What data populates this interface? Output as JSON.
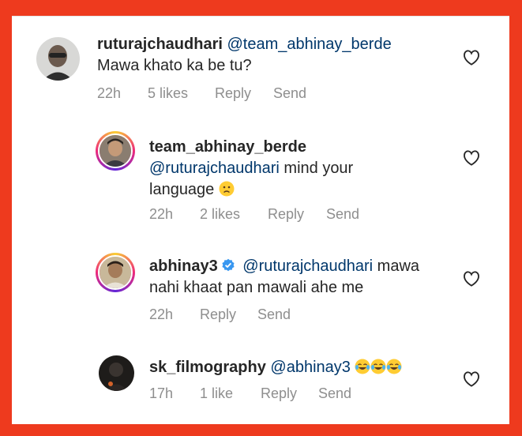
{
  "colors": {
    "background": "#ee3a1e",
    "mention": "#00376b",
    "meta": "#8e8e8e",
    "verified": "#3897f0"
  },
  "comments": [
    {
      "username": "ruturajchaudhari",
      "mention": "@team_abhinay_berde",
      "text": "Mawa khato ka be tu?",
      "time": "22h",
      "likes": "5 likes",
      "reply": "Reply",
      "send": "Send"
    },
    {
      "username": "team_abhinay_berde",
      "mention": "@ruturajchaudhari",
      "text_line1": "mind your",
      "text_line2": "language",
      "emoji": "slightly-frowning-face",
      "time": "22h",
      "likes": "2 likes",
      "reply": "Reply",
      "send": "Send"
    },
    {
      "username": "abhinay3",
      "verified": true,
      "mention": "@ruturajchaudhari",
      "text_line1": "mawa",
      "text_line2": "nahi khaat pan mawali ahe me",
      "time": "22h",
      "reply": "Reply",
      "send": "Send"
    },
    {
      "username": "sk_filmography",
      "mention": "@abhinay3",
      "emoji": "face-with-tears-of-joy x3",
      "time": "17h",
      "likes": "1 like",
      "reply": "Reply",
      "send": "Send"
    }
  ]
}
